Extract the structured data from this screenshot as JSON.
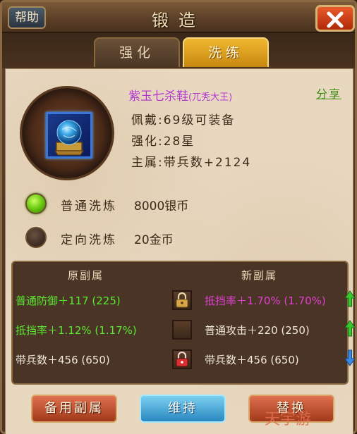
{
  "window": {
    "title": "锻造",
    "help_label": "帮助"
  },
  "tabs": [
    {
      "label": "强化",
      "active": false
    },
    {
      "label": "洗练",
      "active": true
    }
  ],
  "item": {
    "name": "紫玉七杀鞋",
    "owner": "(兀秃大王)",
    "share_label": "分享",
    "wear": "佩戴:69级可装备",
    "strengthen": "强化:28星",
    "main_attr": "主属:带兵数+2124",
    "icon": "blue-orb-relic-icon"
  },
  "options": [
    {
      "label": "普通洗炼",
      "cost": "8000银币",
      "selected": true
    },
    {
      "label": "定向洗炼",
      "cost": "20金币",
      "selected": false
    }
  ],
  "attributes": {
    "original_header": "原副属",
    "new_header": "新副属",
    "rows": [
      {
        "original": "普通防御＋117 (225)",
        "new": "抵挡率＋1.70% (1.70%)",
        "lock": "locked-gold",
        "trend": "up"
      },
      {
        "original": "抵挡率＋1.12% (1.17%)",
        "new": "普通攻击＋220 (250)",
        "lock": "empty",
        "trend": "up"
      },
      {
        "original": "带兵数＋456 (650)",
        "new": "带兵数＋456 (650)",
        "lock": "locked-red",
        "trend": "down"
      }
    ]
  },
  "buttons": {
    "backup": "备用副属",
    "keep": "维持",
    "replace": "替换"
  },
  "watermark": "天宇游",
  "colors": {
    "accent_gold": "#f0b830",
    "item_purple": "#b030c0",
    "attr_green": "#5ae830",
    "attr_pink": "#e040d0",
    "trend_up": "#3ac830",
    "trend_down": "#3a88e8"
  }
}
